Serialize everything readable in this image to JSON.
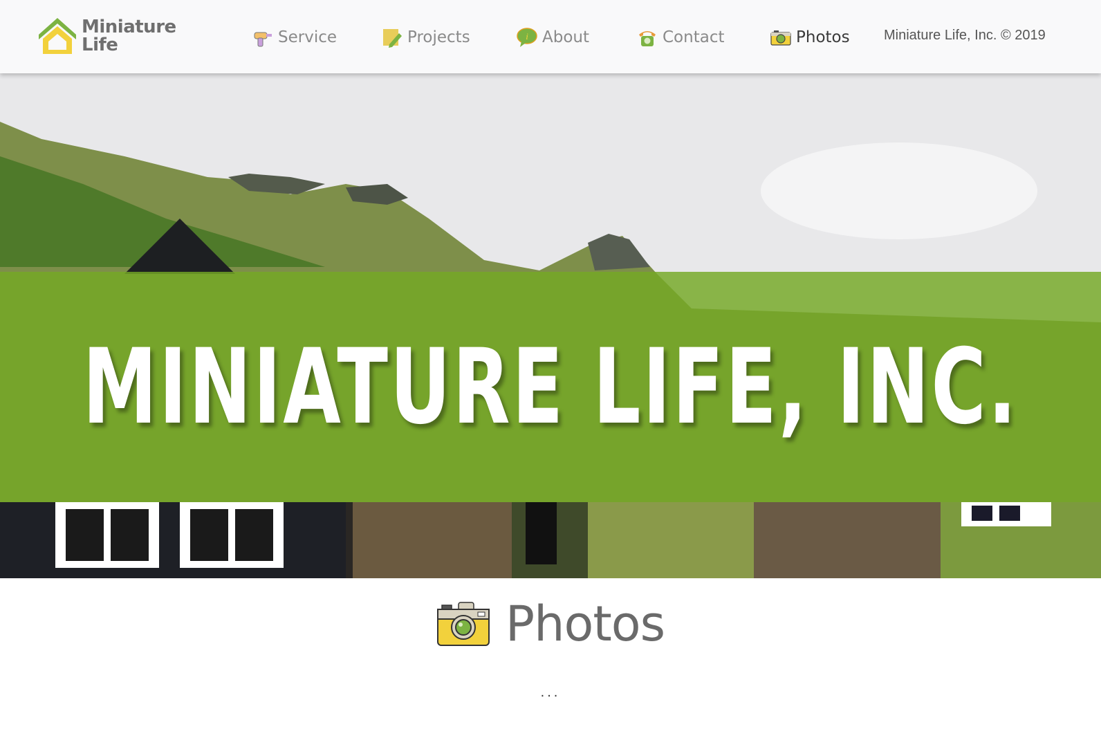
{
  "brand": {
    "logo_line1": "Miniature",
    "logo_line2": "Life",
    "colors": {
      "green": "#7cb342",
      "yellow": "#f2d13c",
      "gray": "#6f6f6f"
    }
  },
  "nav": {
    "items": [
      {
        "label": "Service",
        "icon": "drill-icon",
        "active": false
      },
      {
        "label": "Projects",
        "icon": "note-pencil-icon",
        "active": false
      },
      {
        "label": "About",
        "icon": "info-bubble-icon",
        "active": false
      },
      {
        "label": "Contact",
        "icon": "telephone-icon",
        "active": false
      },
      {
        "label": "Photos",
        "icon": "camera-icon",
        "active": true
      }
    ],
    "copyright": "Miniature Life, Inc. © 2019"
  },
  "hero": {
    "title": "Miniature Life, Inc.",
    "banner_color": "#74a824"
  },
  "section": {
    "title": "Photos",
    "icon": "camera-icon",
    "body": "..."
  }
}
